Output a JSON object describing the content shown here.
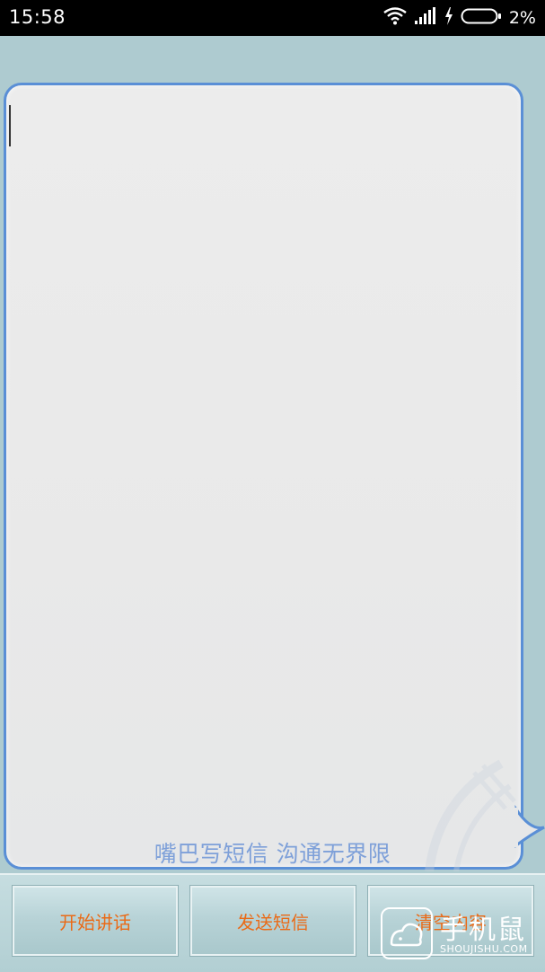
{
  "status_bar": {
    "time": "15:58",
    "battery_percent": "2%",
    "icons": [
      "wifi-icon",
      "signal-icon",
      "charging-icon",
      "battery-icon"
    ]
  },
  "message": {
    "text": "",
    "slogan": "嘴巴写短信 沟通无界限"
  },
  "toolbar": {
    "start_label": "开始讲话",
    "send_label": "发送短信",
    "clear_label": "清空内容"
  },
  "watermark": {
    "brand_cn": "手机鼠",
    "brand_en": "SHOUJISHU.COM"
  },
  "colors": {
    "background": "#aecbd0",
    "bubble_border": "#5a8fd6",
    "button_text": "#ea6a16",
    "slogan_text": "#7ea0d9"
  }
}
